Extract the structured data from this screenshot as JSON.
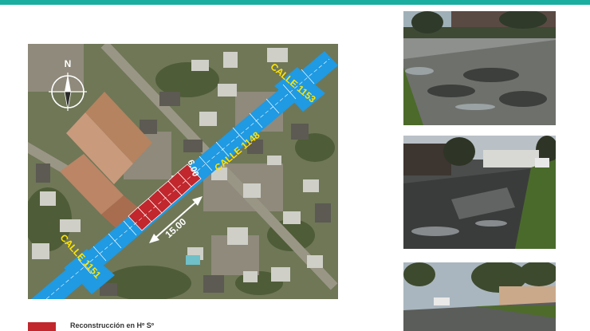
{
  "colors": {
    "accent_bar": "#1aaea1",
    "street_blue": "#1f9ae3",
    "reconstruction_red": "#c1272d",
    "label_yellow": "#ffe400"
  },
  "map": {
    "north_label": "N",
    "icons": [
      "compass-rose-icon",
      "double-arrow-icon"
    ],
    "streets": {
      "calle_1153": "CALLE 1153",
      "calle_1148": "CALLE 1148",
      "calle_1151": "CALLE 1151"
    },
    "dimensions": {
      "width": "6.00",
      "length": "15.00"
    }
  },
  "legend": {
    "reconstruction_label": "Reconstrucción en Hº Sº"
  }
}
